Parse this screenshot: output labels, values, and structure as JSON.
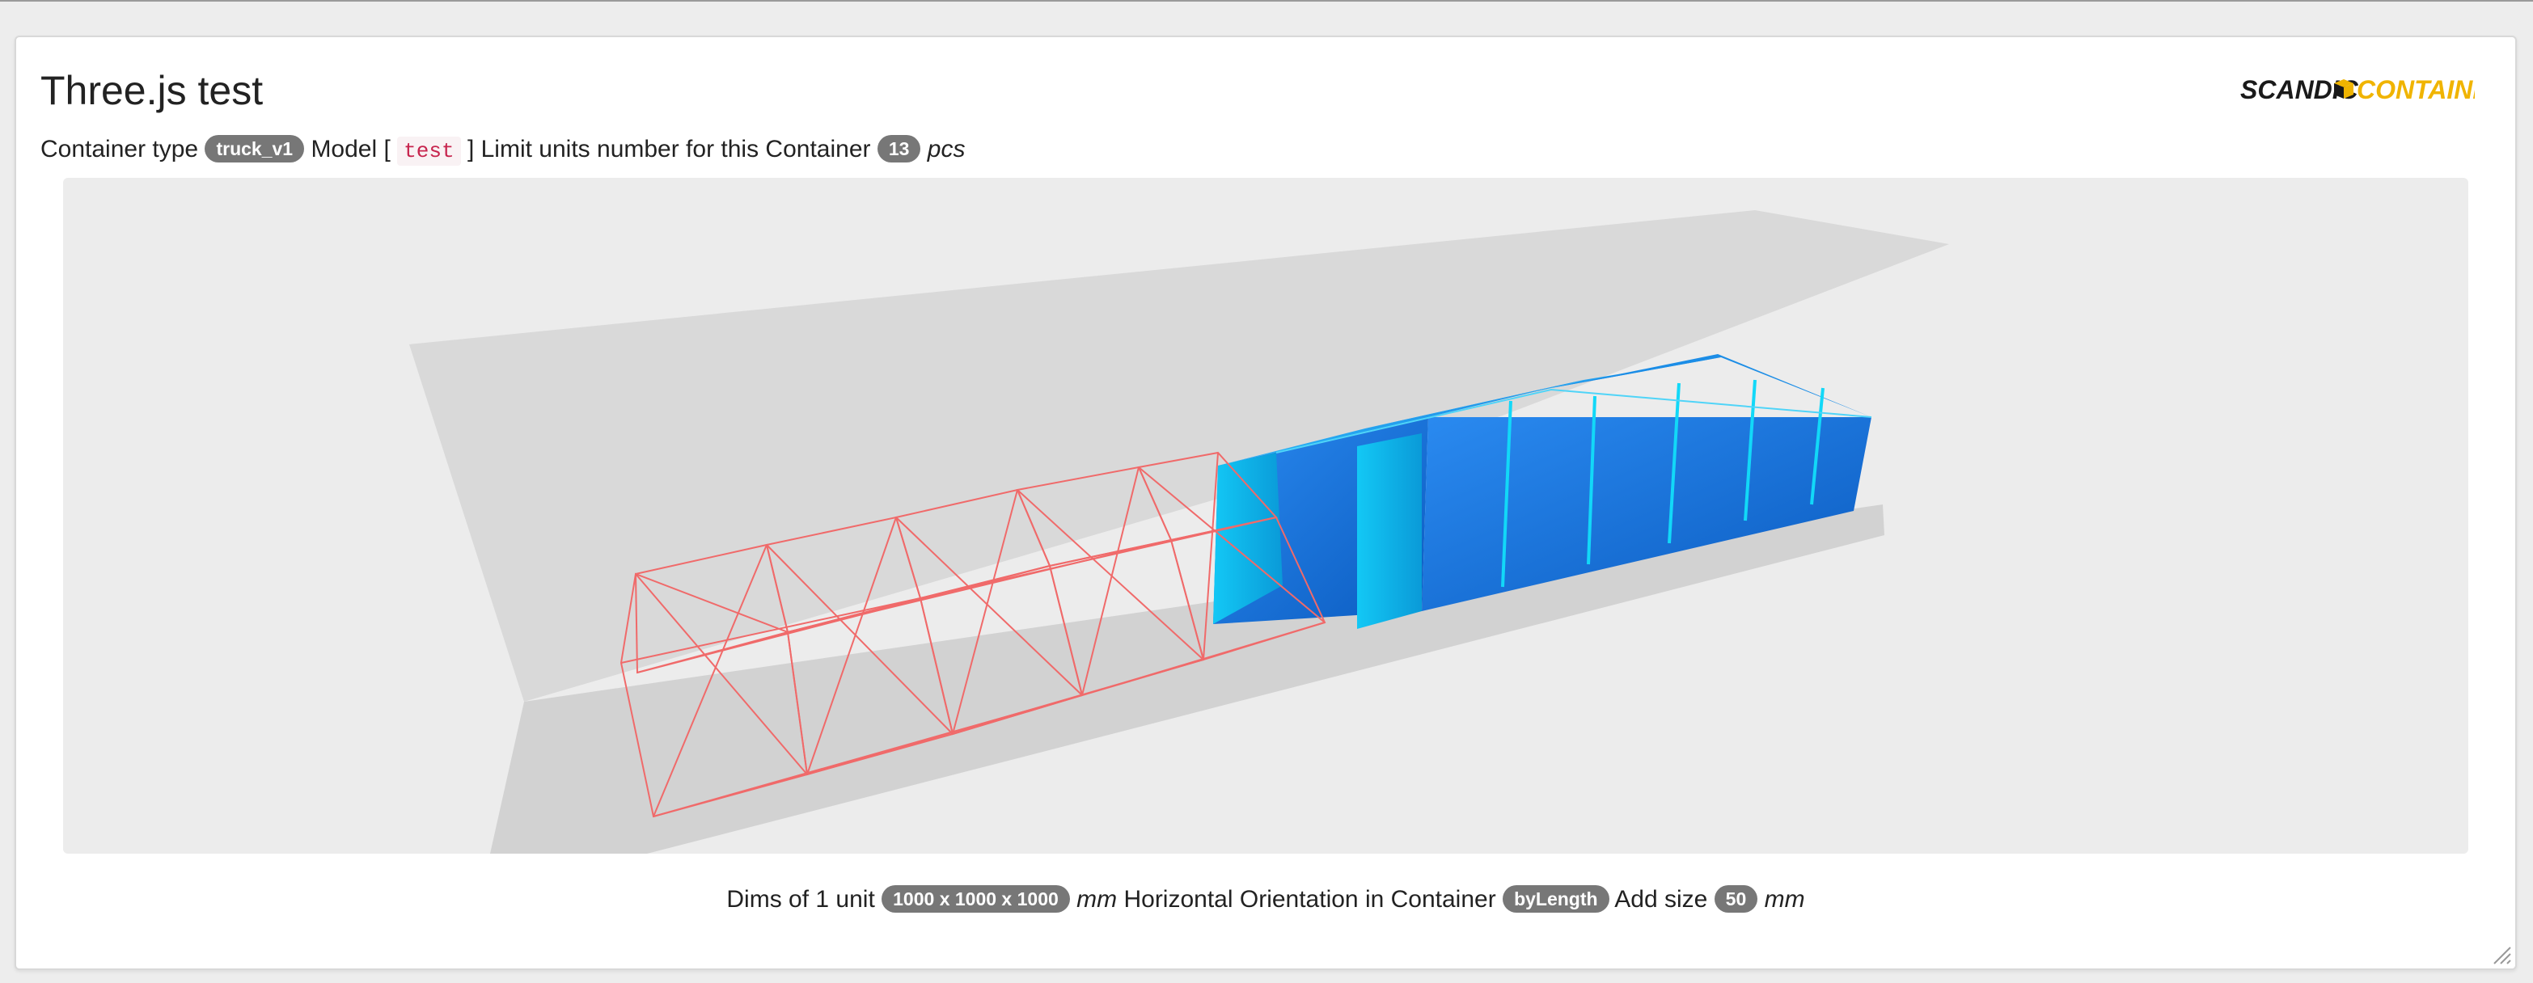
{
  "page": {
    "title": "Three.js test"
  },
  "logo": {
    "text_part1": "SCANDIC",
    "text_part2": "CONTAINER",
    "icon": "box-icon",
    "colors": {
      "part1": "#1a1a1a",
      "part2": "#f0b400"
    }
  },
  "info": {
    "container_label": "Container type",
    "container_type": "truck_v1",
    "model_label_open": "Model [",
    "model_value": "test",
    "model_label_close": "]",
    "limit_label": "Limit units number for this Container",
    "limit_value": "13",
    "limit_unit": "pcs"
  },
  "scene": {
    "loaded_units_color": "#1a7fe0",
    "wireframe_units_color": "#f06a6a",
    "container_color": "#d9d9d9",
    "background_color": "#ececec"
  },
  "dims": {
    "label": "Dims of 1 unit",
    "value": "1000 x 1000 x 1000",
    "unit": "mm",
    "orientation_label": "Horizontal Orientation in Container",
    "orientation_value": "byLength",
    "add_size_label": "Add size",
    "add_size_value": "50",
    "add_size_unit": "mm"
  }
}
